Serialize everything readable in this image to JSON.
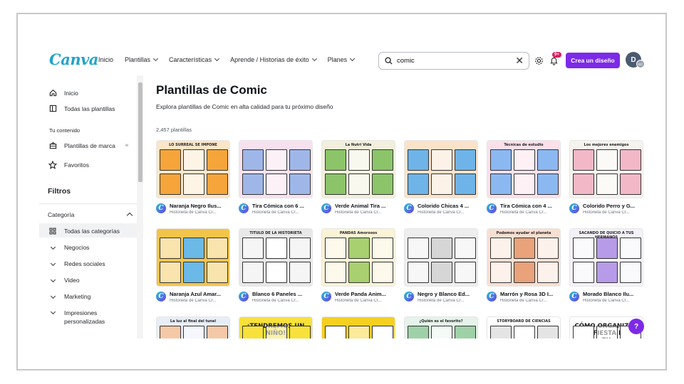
{
  "header": {
    "logo": "Canva",
    "nav": [
      {
        "label": "Inicio",
        "dropdown": false
      },
      {
        "label": "Plantillas",
        "dropdown": true
      },
      {
        "label": "Características",
        "dropdown": true
      },
      {
        "label": "Aprende / Historias de éxito",
        "dropdown": true
      },
      {
        "label": "Planes",
        "dropdown": true
      }
    ],
    "search_value": "comic",
    "notification_badge": "9+",
    "create_button": "Crea un diseño",
    "avatar_initial": "D",
    "avatar_sub": "EC"
  },
  "sidebar": {
    "top_items": [
      {
        "label": "Inicio",
        "icon": "home-icon"
      },
      {
        "label": "Todas las plantillas",
        "icon": "templates-icon"
      }
    ],
    "section_label": "Tu contenido",
    "content_items": [
      {
        "label": "Plantillas de marca",
        "icon": "brand-icon",
        "badge": "w"
      },
      {
        "label": "Favoritos",
        "icon": "star-icon"
      }
    ],
    "filters_title": "Filtros",
    "category_title": "Categoría",
    "categories": [
      {
        "label": "Todas las categorías",
        "icon": "grid-icon",
        "active": true
      },
      {
        "label": "Negocios",
        "icon": "chevron-down-icon"
      },
      {
        "label": "Redes sociales",
        "icon": "chevron-down-icon"
      },
      {
        "label": "Video",
        "icon": "chevron-down-icon"
      },
      {
        "label": "Marketing",
        "icon": "chevron-down-icon"
      },
      {
        "label": "Impresiones personalizadas",
        "icon": "chevron-down-icon"
      }
    ]
  },
  "main": {
    "title": "Plantillas de Comic",
    "subtitle": "Explora plantillas de Comic en alta calidad para tu próximo diseño",
    "count": "2,457 plantillas",
    "templates": [
      {
        "name": "Naranja Negro Ilus...",
        "author": "Historieta de Canva Cr...",
        "bg": "#fbe6c8",
        "accent": "#f5a53a",
        "thumb_title": "LO SURREAL SE IMPONE"
      },
      {
        "name": "Tira Cómica con 6 ...",
        "author": "Historieta de Canva Cr...",
        "bg": "#f8e1ee",
        "accent": "#9fb7e8",
        "thumb_title": ""
      },
      {
        "name": "Verde Animal Tira ...",
        "author": "Historieta de Canva Cr...",
        "bg": "#f2f0dc",
        "accent": "#8cc46a",
        "thumb_title": "La Nutri Vida"
      },
      {
        "name": "Colorido Chicas 4 ...",
        "author": "Historieta de Canva Cr...",
        "bg": "#fbe3c9",
        "accent": "#6fb4e8",
        "thumb_title": ""
      },
      {
        "name": "Tira Cómica con 4 ...",
        "author": "Historieta de Canva Cr...",
        "bg": "#fbe0ea",
        "accent": "#8bb8f0",
        "thumb_title": "Técnicas de estudio"
      },
      {
        "name": "Colorido Perro y G...",
        "author": "Historieta de Canva Cr...",
        "bg": "#f6f3ee",
        "accent": "#f2b8c8",
        "thumb_title": "Los mejores enemigos"
      },
      {
        "name": "Naranja Azul Amar...",
        "author": "Historieta de Canva Cr...",
        "bg": "#f3c44a",
        "accent": "#6ab9e6",
        "thumb_title": ""
      },
      {
        "name": "Blanco 6 Paneles ...",
        "author": "Historieta de Canva Cr...",
        "bg": "#e8e8e8",
        "accent": "#ffffff",
        "thumb_title": "TITULO DE LA HISTORIETA"
      },
      {
        "name": "Verde Panda Anim...",
        "author": "Historieta de Canva Cr...",
        "bg": "#fbf3d6",
        "accent": "#a8d070",
        "thumb_title": "PANDAS Amorosos"
      },
      {
        "name": "Negro y Blanco Ed...",
        "author": "Historieta de Canva Cr...",
        "bg": "#eeeeee",
        "accent": "#d6d6d6",
        "thumb_title": ""
      },
      {
        "name": "Marrón y Rosa 3D I...",
        "author": "Historieta de Canva Cr...",
        "bg": "#f9dfd2",
        "accent": "#e9a27a",
        "thumb_title": "Podemos ayudar el planeta"
      },
      {
        "name": "Morado Blanco Ilu...",
        "author": "Historieta de Canva Cr...",
        "bg": "#f4f1f8",
        "accent": "#b79be8",
        "thumb_title": "SACANDO DE QUICIO A TUS HERMANOS"
      },
      {
        "name": "",
        "author": "",
        "bg": "#e8eef8",
        "accent": "#f5c9a8",
        "thumb_title": "La luz al final del tunel"
      },
      {
        "name": "",
        "author": "",
        "bg": "#f7e13a",
        "accent": "#f7e13a",
        "thumb_title": "¡TENDREMOS UN NIÑO!"
      },
      {
        "name": "",
        "author": "",
        "bg": "#f5d020",
        "accent": "#ffffff",
        "thumb_title": ""
      },
      {
        "name": "",
        "author": "",
        "bg": "#e6f3ea",
        "accent": "#9fd1a8",
        "thumb_title": "¿Quién es el favorito?"
      },
      {
        "name": "",
        "author": "",
        "bg": "#ffffff",
        "accent": "#e4e4e4",
        "thumb_title": "STORYBOARD DE CIENCIAS"
      },
      {
        "name": "",
        "author": "",
        "bg": "#ffffff",
        "accent": "#ffffff",
        "thumb_title": "CÓMO ORGANIZAR UNA FIESTA PARA TU"
      }
    ]
  },
  "help_label": "?"
}
